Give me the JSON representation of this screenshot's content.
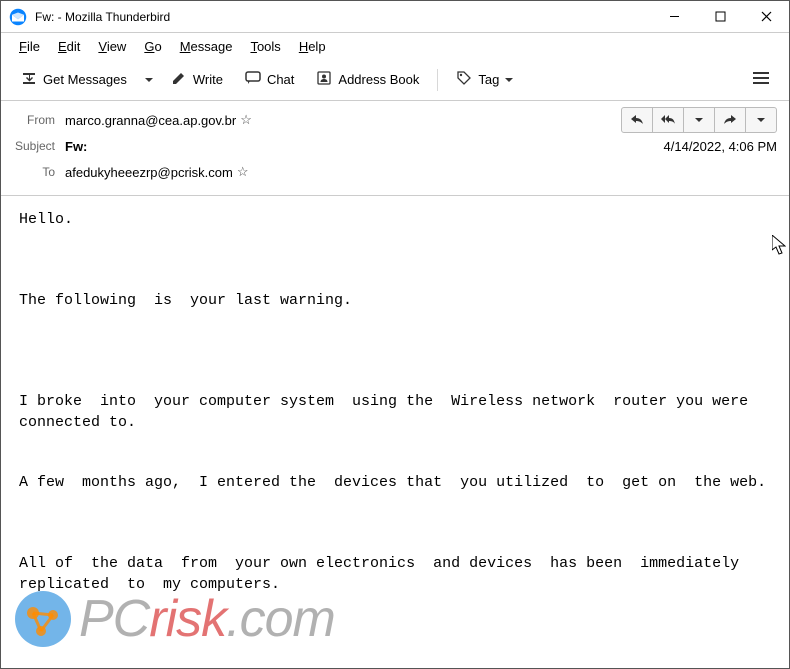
{
  "window": {
    "title": "Fw: - Mozilla Thunderbird"
  },
  "menu": {
    "file": "File",
    "edit": "Edit",
    "view": "View",
    "go": "Go",
    "message": "Message",
    "tools": "Tools",
    "help": "Help"
  },
  "toolbar": {
    "get_messages": "Get Messages",
    "write": "Write",
    "chat": "Chat",
    "address_book": "Address Book",
    "tag": "Tag"
  },
  "headers": {
    "from_label": "From",
    "from_value": "marco.granna@cea.ap.gov.br",
    "subject_label": "Subject",
    "subject_value": "Fw:",
    "to_label": "To",
    "to_value": "afedukyheeezrp@pcrisk.com",
    "date": "4/14/2022, 4:06 PM"
  },
  "body": "Hello.\n\n\n\nThe following  is  your last warning.\n\n\n\n\nI broke  into  your computer system  using the  Wireless network  router you were connected to.\n\n\nA few  months ago,  I entered the  devices that  you utilized  to  get on  the web.\n\n\n\nAll of  the data  from  your own electronics  and devices  has been  immediately replicated  to  my computers.",
  "watermark": {
    "pc": "PC",
    "risk": "risk",
    "dotcom": ".com"
  }
}
